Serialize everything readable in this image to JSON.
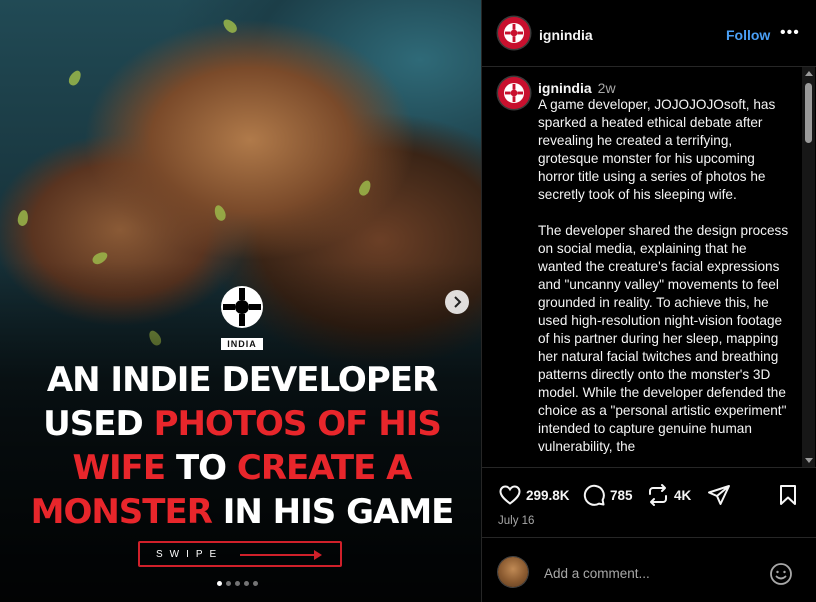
{
  "post_image": {
    "badge_label": "INDIA",
    "headline": {
      "line1": "AN INDIE DEVELOPER",
      "line2_white": "USED ",
      "line2_red": "PHOTOS OF HIS",
      "line3_red1": "WIFE",
      "line3_white": " TO ",
      "line3_red2": "CREATE A",
      "line4_red": "MONSTER",
      "line4_white": " IN HIS GAME"
    },
    "swipe_label": "SWIPE",
    "next_icon": "chevron-right-icon",
    "carousel_dots": 5,
    "active_dot": 1
  },
  "header": {
    "username": "ignindia",
    "follow_label": "Follow",
    "more_icon": "more-horizontal-icon",
    "more_label": "•••"
  },
  "caption": {
    "username": "ignindia",
    "time": "2w",
    "paragraph1": "A game developer,  JOJOJOJOsoft, has sparked a heated ethical debate after revealing he created a terrifying, grotesque monster for his upcoming horror title using a series of photos he secretly took of his sleeping wife.",
    "paragraph2": "The developer shared the design process on social media, explaining that he wanted the creature's facial expressions and \"uncanny valley\" movements to feel grounded in reality. To achieve this, he used high-resolution night-vision footage of his partner during her sleep, mapping her natural facial twitches and breathing patterns directly onto the monster's 3D model. While the developer defended the choice as a \"personal artistic experiment\" intended to capture genuine human vulnerability, the"
  },
  "actions": {
    "likes": "299.8K",
    "comments": "785",
    "reposts": "4K",
    "date": "July 16",
    "icons": [
      "heart-icon",
      "comment-icon",
      "repost-icon",
      "share-icon",
      "bookmark-icon"
    ]
  },
  "comment_box": {
    "placeholder": "Add a comment...",
    "emoji_icon": "smiley-icon"
  },
  "colors": {
    "accent_blue": "#4a9ff5",
    "headline_red": "#e8262b",
    "ign_red": "#c8102e",
    "background": "#000000",
    "muted_text": "#a8a8a8"
  }
}
